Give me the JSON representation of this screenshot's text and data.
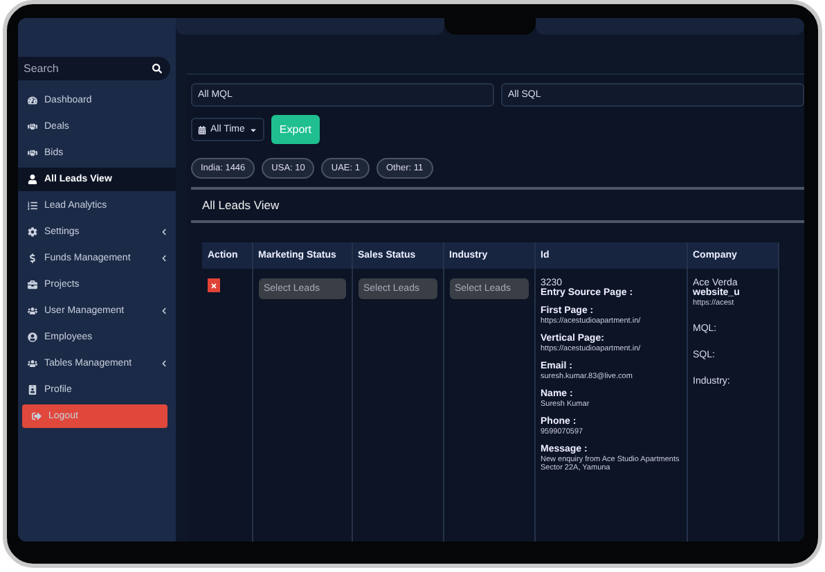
{
  "sidebar": {
    "search": {
      "placeholder": "Search"
    },
    "items": [
      {
        "label": "Dashboard",
        "selected": false,
        "has_submenu": false,
        "kind": "link"
      },
      {
        "label": "Deals",
        "selected": false,
        "has_submenu": false,
        "kind": "link"
      },
      {
        "label": "Bids",
        "selected": false,
        "has_submenu": false,
        "kind": "link"
      },
      {
        "label": "All Leads View",
        "selected": true,
        "has_submenu": false,
        "kind": "link"
      },
      {
        "label": "Lead Analytics",
        "selected": false,
        "has_submenu": false,
        "kind": "link"
      },
      {
        "label": "Settings",
        "selected": false,
        "has_submenu": true,
        "kind": "link"
      },
      {
        "label": "Funds Management",
        "selected": false,
        "has_submenu": true,
        "kind": "link"
      },
      {
        "label": "Projects",
        "selected": false,
        "has_submenu": false,
        "kind": "link"
      },
      {
        "label": "User Management",
        "selected": false,
        "has_submenu": true,
        "kind": "link"
      },
      {
        "label": "Employees",
        "selected": false,
        "has_submenu": false,
        "kind": "link"
      },
      {
        "label": "Tables Management",
        "selected": false,
        "has_submenu": true,
        "kind": "link"
      },
      {
        "label": "Profile",
        "selected": false,
        "has_submenu": false,
        "kind": "link"
      },
      {
        "label": "Logout",
        "selected": false,
        "has_submenu": false,
        "kind": "logout"
      }
    ]
  },
  "filters": {
    "mql": "All MQL",
    "sql": "All SQL",
    "time": "All Time",
    "export": "Export"
  },
  "chips": [
    "India: 1446",
    "USA: 10",
    "UAE: 1",
    "Other: 11"
  ],
  "section_title": "All Leads View",
  "table": {
    "columns": [
      "Action",
      "Marketing Status",
      "Sales Status",
      "Industry",
      "Id",
      "Company"
    ],
    "rows": [
      {
        "selects": [
          "Select Leads",
          "Select Leads",
          "Select Leads"
        ],
        "id": "3230",
        "details": [
          {
            "label": "Entry Source Page :"
          },
          {
            "label": "First Page :",
            "value": "https://acestudioapartment.in/"
          },
          {
            "label": "Vertical Page:",
            "value": "https://acestudioapartment.in/"
          },
          {
            "label": "Email :",
            "value": "suresh.kumar.83@live.com"
          },
          {
            "label": "Name :",
            "value": "Suresh Kumar"
          },
          {
            "label": "Phone :",
            "value": "9599070597"
          },
          {
            "label": "Message :",
            "value": "New enquiry from Ace Studio Apartments Sector 22A, Yamuna"
          }
        ],
        "company": {
          "name": "Ace Verda",
          "label": "website_u",
          "value": "https://acest",
          "fields": [
            "MQL:",
            "SQL:",
            "Industry:"
          ]
        }
      }
    ]
  }
}
